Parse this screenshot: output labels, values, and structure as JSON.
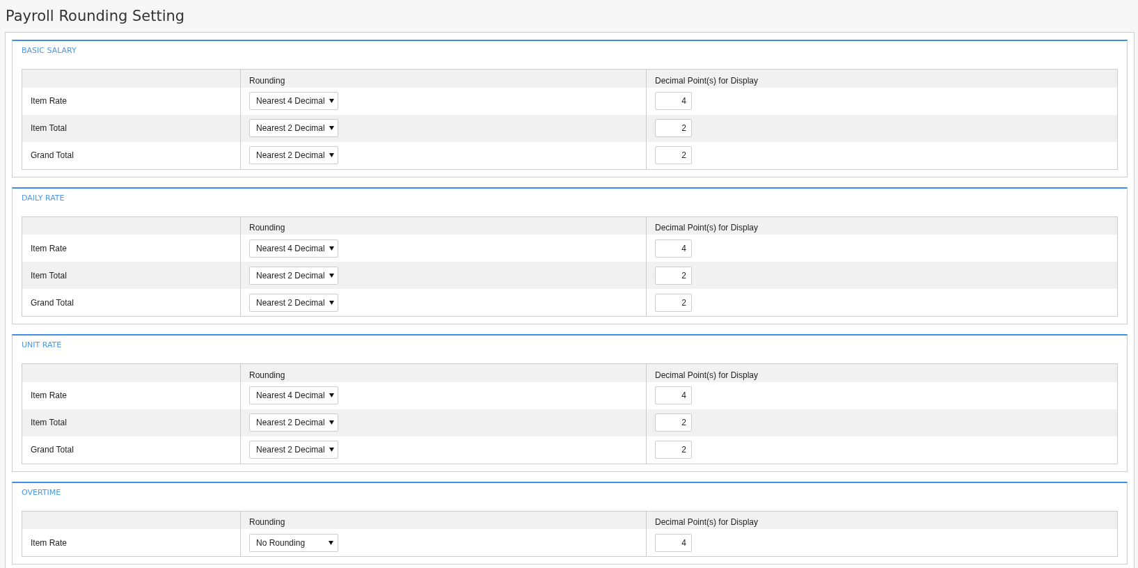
{
  "page": {
    "title": "Payroll Rounding Setting"
  },
  "sections": [
    {
      "title": "BASIC SALARY",
      "columns": [
        "Rounding",
        "Decimal Point(s) for Display"
      ],
      "rows": [
        {
          "label": "Item Rate",
          "rounding": "Nearest 4 Decimal",
          "decimals": "4"
        },
        {
          "label": "Item Total",
          "rounding": "Nearest 2 Decimal",
          "decimals": "2"
        },
        {
          "label": "Grand Total",
          "rounding": "Nearest 2 Decimal",
          "decimals": "2"
        }
      ]
    },
    {
      "title": "DAILY RATE",
      "columns": [
        "Rounding",
        "Decimal Point(s) for Display"
      ],
      "rows": [
        {
          "label": "Item Rate",
          "rounding": "Nearest 4 Decimal",
          "decimals": "4"
        },
        {
          "label": "Item Total",
          "rounding": "Nearest 2 Decimal",
          "decimals": "2"
        },
        {
          "label": "Grand Total",
          "rounding": "Nearest 2 Decimal",
          "decimals": "2"
        }
      ]
    },
    {
      "title": "UNIT RATE",
      "columns": [
        "Rounding",
        "Decimal Point(s) for Display"
      ],
      "rows": [
        {
          "label": "Item Rate",
          "rounding": "Nearest 4 Decimal",
          "decimals": "4"
        },
        {
          "label": "Item Total",
          "rounding": "Nearest 2 Decimal",
          "decimals": "2"
        },
        {
          "label": "Grand Total",
          "rounding": "Nearest 2 Decimal",
          "decimals": "2"
        }
      ]
    },
    {
      "title": "OVERTIME",
      "columns": [
        "Rounding",
        "Decimal Point(s) for Display"
      ],
      "rows": [
        {
          "label": "Item Rate",
          "rounding": "No Rounding",
          "decimals": "4"
        }
      ]
    }
  ]
}
